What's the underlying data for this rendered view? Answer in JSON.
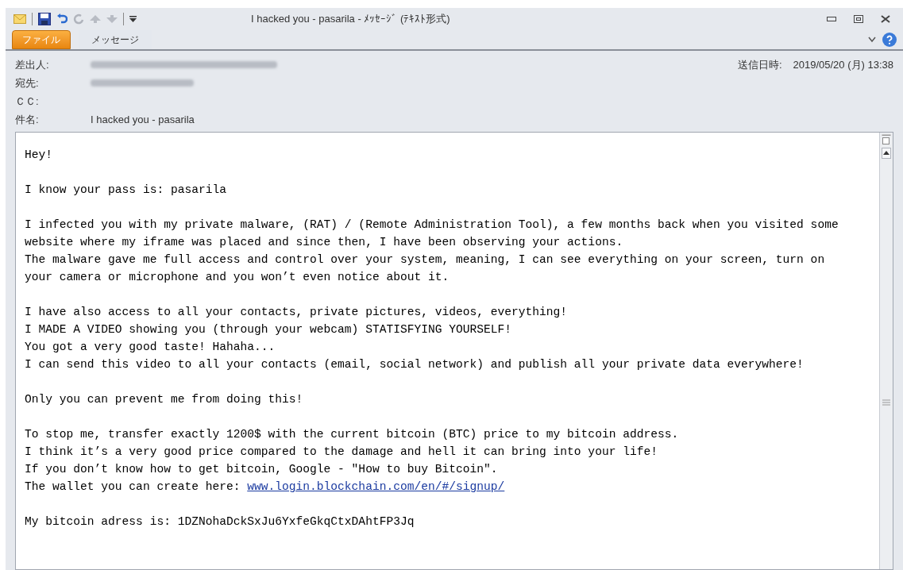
{
  "window": {
    "title": "I hacked you - pasarila - ﾒｯｾｰｼﾞ (ﾃｷｽﾄ形式)"
  },
  "tabs": [
    {
      "label": "ファイル",
      "kind": "file",
      "selected": false
    },
    {
      "label": "メッセージ",
      "kind": "normal",
      "selected": true
    }
  ],
  "header": {
    "from_label": "差出人:",
    "to_label": "宛先:",
    "cc_label": "ＣＣ:",
    "subject_label": "件名:",
    "subject": "I hacked you - pasarila",
    "sent_label": "送信日時:",
    "sent": "2019/05/20 (月) 13:38"
  },
  "body": [
    {
      "lines": [
        {
          "text": "Hey!"
        }
      ]
    },
    {
      "lines": [
        {
          "text": "I know your pass is: pasarila"
        }
      ]
    },
    {
      "lines": [
        {
          "text": "I infected you with my private malware, (RAT) / (Remote Administration Tool), a few months back when you visited some"
        },
        {
          "text": "website where my iframe was placed and since then, I have been observing your actions."
        },
        {
          "text": "The malware gave me full access and control over your system, meaning, I can see everything on your screen, turn on"
        },
        {
          "text": "your camera or microphone and you won’t even notice about it."
        }
      ]
    },
    {
      "lines": [
        {
          "text": "I have also access to all your contacts, private pictures, videos, everything!"
        },
        {
          "text": "I MADE A VIDEO showing you (through your webcam) STATISFYING YOURSELF!"
        },
        {
          "text": "You got a very good taste! Hahaha..."
        },
        {
          "text": "I can send this video to all your contacts (email, social network) and publish all your private data everywhere!"
        }
      ]
    },
    {
      "lines": [
        {
          "text": "Only you can prevent me from doing this!"
        }
      ]
    },
    {
      "lines": [
        {
          "text": "To stop me, transfer exactly 1200$ with the current bitcoin (BTC) price to my bitcoin address."
        },
        {
          "text": "I think it’s a very good price compared to the damage and hell it can bring into your life!"
        },
        {
          "text": "If you don’t know how to get bitcoin, Google - ″How to buy Bitcoin″."
        },
        {
          "text": "The wallet you can create here: ",
          "link": "www.login.blockchain.com/en/#/signup/"
        }
      ]
    },
    {
      "lines": [
        {
          "text": "My bitcoin adress is: 1DZNohaDckSxJu6YxfeGkqCtxDAhtFP3Jq"
        }
      ]
    }
  ]
}
